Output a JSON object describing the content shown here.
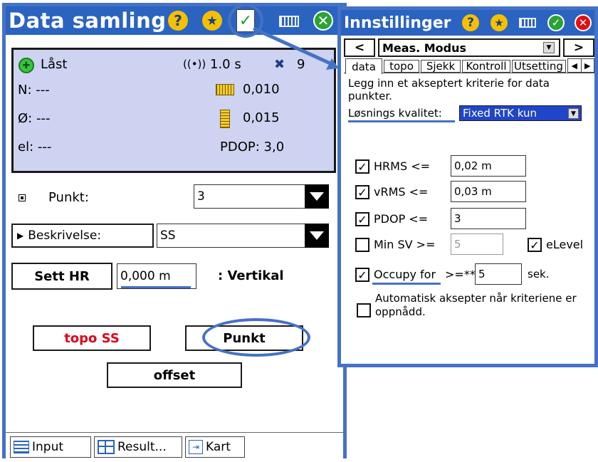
{
  "left_window": {
    "title": "Data samling",
    "status": {
      "lock_label": "Låst",
      "age": "1.0 s",
      "sats": "9",
      "n_label": "N: ---",
      "e_label": "Ø: ---",
      "el_label": "el: ---",
      "hrms": "0,010",
      "vrms": "0,015",
      "pdop": "PDOP: 3,0"
    },
    "point_label": "Punkt:",
    "point_value": "3",
    "desc_label": "Beskrivelse:",
    "desc_value": "SS",
    "sett_hr_label": "Sett HR",
    "hr_value": "0,000 m",
    "vertical_label": ": Vertikal",
    "topo_button": "topo SS",
    "punkt_button": "Punkt",
    "offset_button": "offset",
    "tabs": [
      "Input",
      "Result...",
      "Kart"
    ]
  },
  "right_window": {
    "title": "Innstillinger",
    "nav_prev": "<",
    "nav_next": ">",
    "mode_label": "Meas. Modus",
    "tabs": [
      "data",
      "topo",
      "Sjekk",
      "Kontroll",
      "Utsetting"
    ],
    "description": "Legg inn et akseptert kriterie for  data punkter.",
    "quality_label": "Løsnings kvalitet:",
    "quality_value": "Fixed RTK kun",
    "hrms_label": "HRMS <=",
    "hrms_value": "0,02 m",
    "vrms_label": "vRMS <=",
    "vrms_value": "0,03 m",
    "pdop_label": "PDOP <=",
    "pdop_value": "3",
    "minsv_label": "Min SV >=",
    "minsv_value": "5",
    "elevel_label": "eLevel",
    "occupy_label": "Occupy for",
    "occupy_op": ">=**",
    "occupy_value": "5",
    "occupy_unit": "sek.",
    "auto_accept_label": "Automatisk aksepter når kriteriene er oppnådd."
  },
  "colors": {
    "titlebar": "#2b63c0",
    "frame": "#4472c4",
    "status_panel": "#cdd3f0",
    "topo_text": "#e0001b",
    "quality_bg": "#2145c8"
  }
}
